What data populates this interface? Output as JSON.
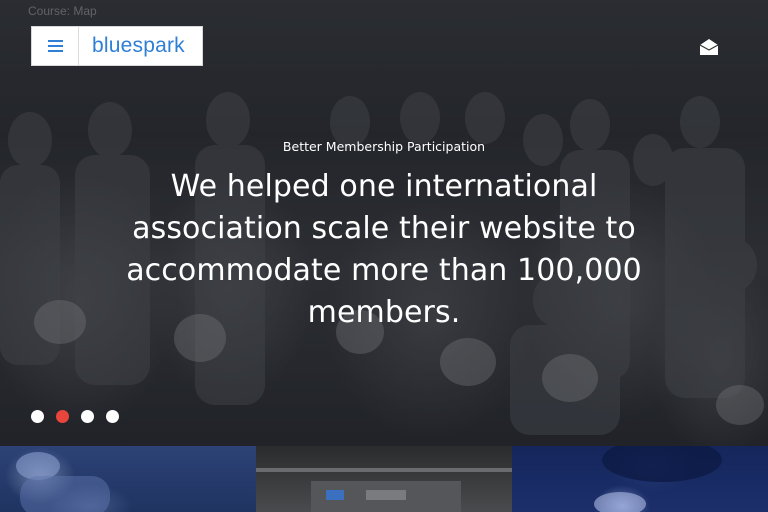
{
  "background_text": "Course: Map",
  "header": {
    "brand": "bluespark",
    "menu_icon": "hamburger-icon",
    "contact_icon": "envelope-icon",
    "brand_color": "#2f7fd6"
  },
  "hero": {
    "kicker": "Better Membership Participation",
    "headline": "We helped one international association scale their website to accommodate more than 100,000 members.",
    "slides": {
      "count": 4,
      "active_index": 1
    },
    "accent_color": "#e8453c"
  },
  "tiles": [
    {
      "image": "climber-photo"
    },
    {
      "image": "interior-photo"
    },
    {
      "image": "night-tree-photo"
    }
  ]
}
